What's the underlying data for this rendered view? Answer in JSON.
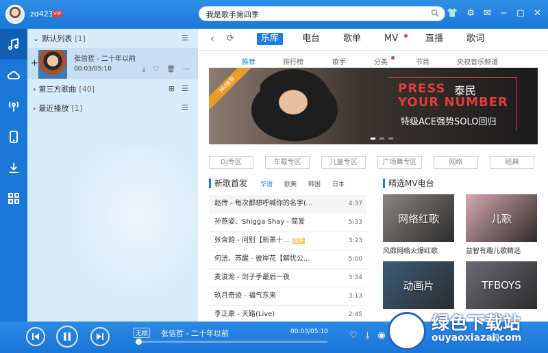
{
  "user": {
    "name": "zd423",
    "vip_label": "VIP"
  },
  "search": {
    "value": "我是歌手第四季"
  },
  "window_icons": [
    "tshirt-icon",
    "settings-icon",
    "mail-icon",
    "minimize-icon",
    "maximize-icon",
    "close-icon"
  ],
  "playlist": {
    "default_list": {
      "label": "默认列表",
      "count": "[1]"
    },
    "current_song": {
      "title": "张信哲 - 二十年以前",
      "time": "00:03/05:10"
    },
    "third_party": {
      "label": "第三方歌曲",
      "count": "[40]"
    },
    "recent": {
      "label": "最近播放",
      "count": "[1]"
    }
  },
  "main_tabs": [
    "乐库",
    "电台",
    "歌单",
    "MV",
    "直播",
    "歌词"
  ],
  "sub_tabs": [
    "推荐",
    "排行榜",
    "歌手",
    "分类",
    "节目",
    "央视音乐频道"
  ],
  "banner": {
    "ribbon": "MV推荐",
    "line1": "PRESS",
    "name": "泰民",
    "line2": "YOUR NUMBER",
    "subtitle": "特级ACE强势SOLO回归"
  },
  "genres": [
    "DJ专区",
    "车载专区",
    "儿童专区",
    "广场舞专区",
    "网络",
    "经典"
  ],
  "new_songs": {
    "title": "新歌首发",
    "filters": [
      "华语",
      "欧美",
      "韩国",
      "日本"
    ],
    "rows": [
      {
        "title": "赵传 - 每次都想呼喊你的名字(...",
        "dur": "4:37"
      },
      {
        "title": "孙燕姿、Shigga Shay - 简爱",
        "dur": "5:33"
      },
      {
        "title": "张含韵 - 问别【新萧十...",
        "dur": "3:23",
        "tag": "原声"
      },
      {
        "title": "何洁、苏醒 - 彼岸花【解忧公...",
        "dur": "5:00"
      },
      {
        "title": "麦浚龙 - 剑子手最后一夜",
        "dur": "3:34"
      },
      {
        "title": "玖月奇迹 - 福气东来",
        "dur": "3:13"
      },
      {
        "title": "李正康 - 天路(Live)",
        "dur": "2:45"
      }
    ]
  },
  "mv_radio": {
    "title": "精选MV电台",
    "items": [
      {
        "label": "网络红歌",
        "caption": "风靡网络火爆红歌",
        "color": "#8a8480"
      },
      {
        "label": "儿歌",
        "caption": "益智有趣儿歌精选",
        "color": "#d8a7b0"
      },
      {
        "label": "动画片",
        "caption": "",
        "color": "#3b5c79"
      },
      {
        "label": "TFBOYS",
        "caption": "",
        "color": "#6b6c73"
      }
    ]
  },
  "player": {
    "quality": "无损",
    "title": "张信哲 - 二十年以前",
    "time": "00:03/05:10",
    "progress": 0.01,
    "lyric_label": "词"
  },
  "watermark": {
    "text": "绿色下载站",
    "url": "ouyaoxiazai.com"
  }
}
